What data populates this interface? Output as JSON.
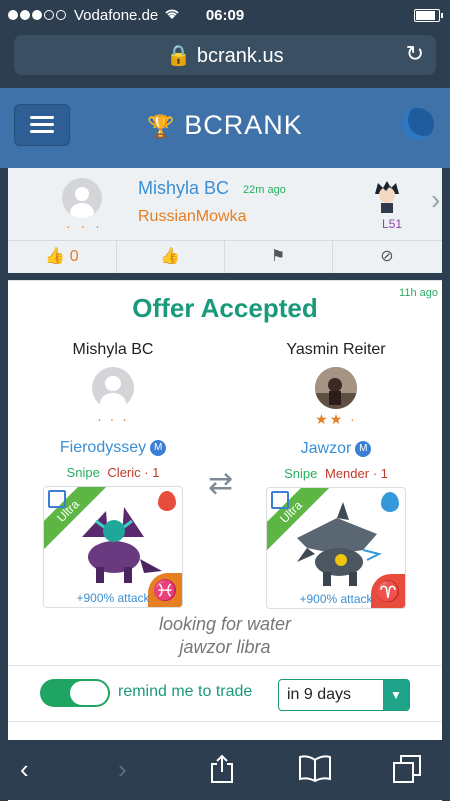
{
  "status_bar": {
    "carrier": "Vodafone.de",
    "time": "06:09"
  },
  "browser": {
    "url": "bcrank.us"
  },
  "header": {
    "logo_bc": "BC",
    "logo_rank": "RANK"
  },
  "profile": {
    "username": "Mishyla BC",
    "time_ago": "22m ago",
    "owner_monster": "RussianMowka",
    "rating_dots": "· · ·",
    "level": "L51",
    "like_count": "0"
  },
  "offer": {
    "title": "Offer Accepted",
    "time_ago": "11h ago",
    "left": {
      "trader": "Mishyla BC",
      "rating": "· · ·",
      "monster": "Fierodyssey",
      "badge": "M",
      "role": "Snipe",
      "class": "Cleric · 1",
      "rarity": "Ultra",
      "attack": "+900% attack",
      "element_color": "#e74c3c",
      "sign_color": "#e67e22",
      "sign_symbol": "♓"
    },
    "right": {
      "trader": "Yasmin Reiter",
      "rating": "★★ ·",
      "monster": "Jawzor",
      "badge": "M",
      "role": "Snipe",
      "class": "Mender · 1",
      "rarity": "Ultra",
      "attack": "+900% attack",
      "element_color": "#3498db",
      "sign_color": "#e74c3c",
      "sign_symbol": "♈"
    },
    "comment_line1": "looking for water",
    "comment_line2": "jawzor libra",
    "remind_label": "remind me to trade",
    "remind_value": "in 9 days",
    "remind_on": true
  },
  "colors": {
    "brand_blue": "#3f72a8",
    "accent_green": "#1a9a7a"
  }
}
